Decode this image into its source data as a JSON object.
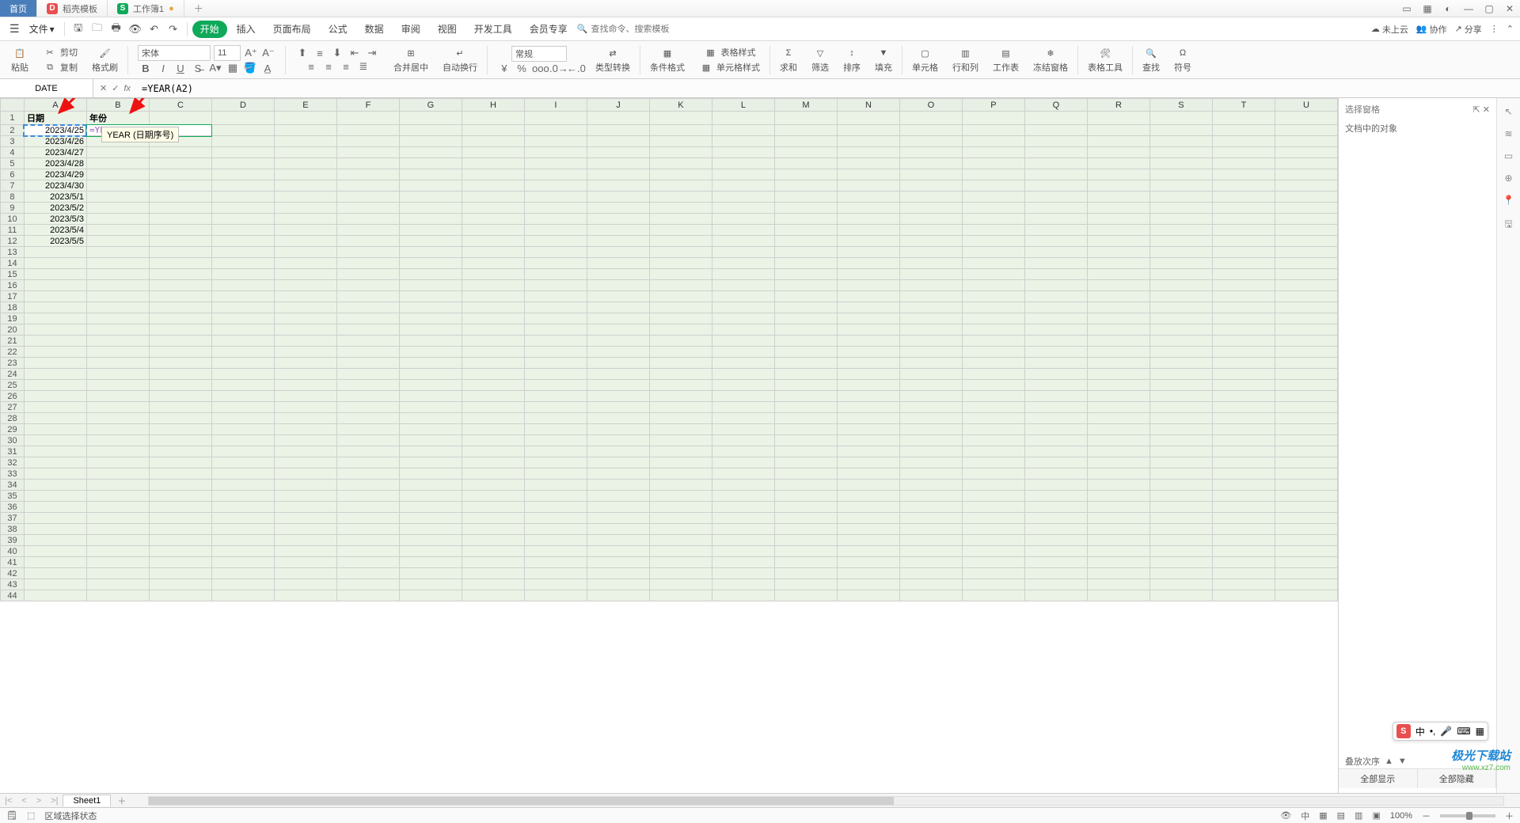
{
  "tabs": {
    "home": "首页",
    "doc": "稻壳模板",
    "book": "工作簿1"
  },
  "menu": {
    "file": "文件",
    "start": "开始",
    "insert": "插入",
    "layout": "页面布局",
    "formula": "公式",
    "data": "数据",
    "review": "审阅",
    "view": "视图",
    "dev": "开发工具",
    "vip": "会员专享",
    "searchcmd": "查找命令、搜索模板"
  },
  "topright": {
    "cloud": "未上云",
    "collab": "协作",
    "share": "分享"
  },
  "ribbon": {
    "paste": "粘贴",
    "cut": "剪切",
    "copy": "复制",
    "brush": "格式刷",
    "font": "宋体",
    "size": "11",
    "merge": "合并居中",
    "wrap": "自动换行",
    "numfmt": "常规",
    "type": "类型转换",
    "cond": "条件格式",
    "tfmt": "表格样式",
    "cfmt": "单元格样式",
    "sum": "求和",
    "filter": "筛选",
    "sort": "排序",
    "fill": "填充",
    "cell": "单元格",
    "rowcol": "行和列",
    "sheet": "工作表",
    "freeze": "冻结窗格",
    "tools": "表格工具",
    "find": "查找",
    "symbol": "符号"
  },
  "fbar": {
    "name": "DATE",
    "formula": "=YEAR(A2)"
  },
  "cols": [
    "A",
    "B",
    "C",
    "D",
    "E",
    "F",
    "G",
    "H",
    "I",
    "J",
    "K",
    "L",
    "M",
    "N",
    "O",
    "P",
    "Q",
    "R",
    "S",
    "T",
    "U"
  ],
  "headers": {
    "a": "日期",
    "b": "年份"
  },
  "dates": [
    "2023/4/25",
    "2023/4/26",
    "2023/4/27",
    "2023/4/28",
    "2023/4/29",
    "2023/4/30",
    "2023/5/1",
    "2023/5/2",
    "2023/5/3",
    "2023/5/4",
    "2023/5/5"
  ],
  "edit": {
    "raw": "=YEAR(A2)",
    "hint": "YEAR (日期序号)"
  },
  "rpane": {
    "title": "选择窗格",
    "objects": "文档中的对象",
    "order": "叠放次序",
    "showAll": "全部显示",
    "hideAll": "全部隐藏"
  },
  "sheet": {
    "name": "Sheet1"
  },
  "status": {
    "mode": "区域选择状态",
    "zoom": "100%"
  },
  "ime": {
    "lang": "中"
  },
  "wm": {
    "l1": "极光下载站",
    "l2": "www.xz7.com"
  },
  "rows": 44
}
